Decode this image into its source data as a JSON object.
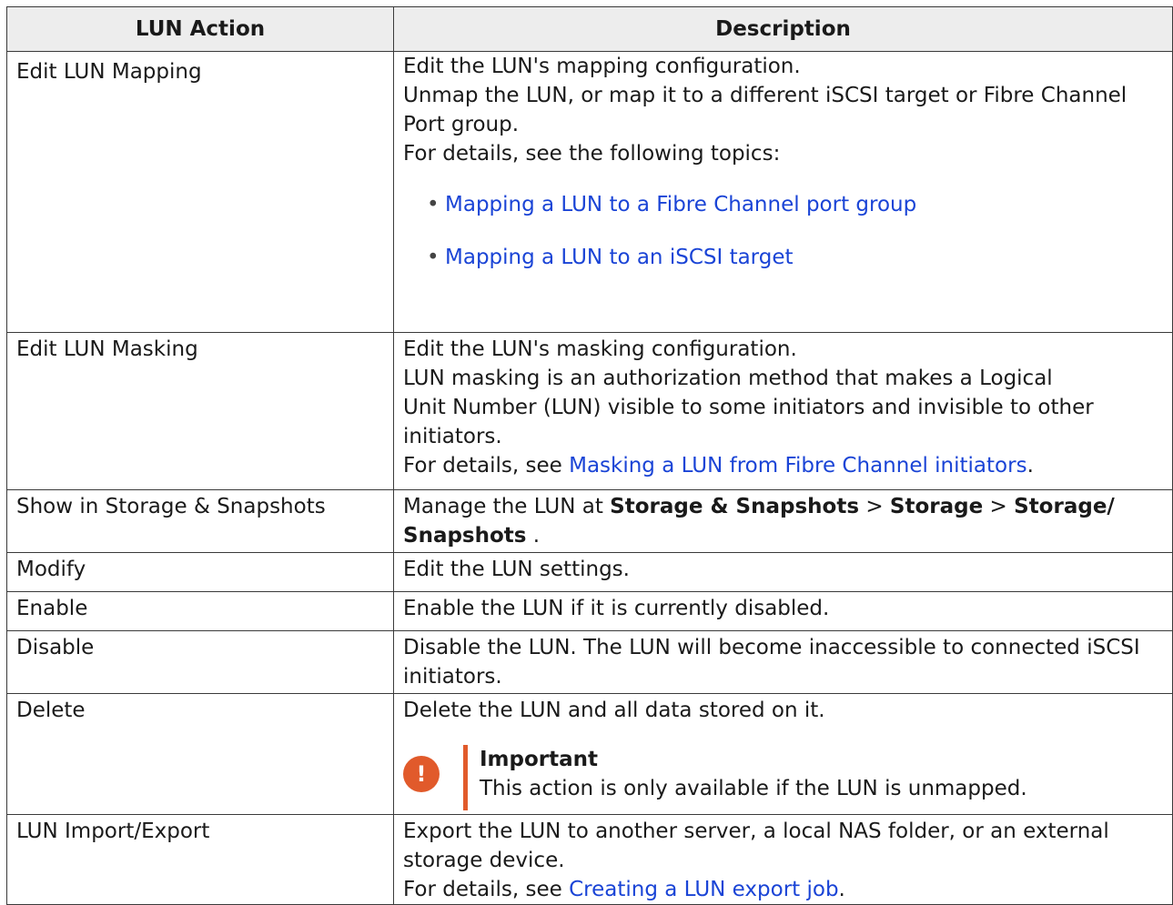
{
  "headers": {
    "action": "LUN Action",
    "description": "Description"
  },
  "rows": {
    "edit_mapping": {
      "action": "Edit LUN Mapping",
      "line1": "Edit the LUN's mapping configuration.",
      "line2": "Unmap the LUN, or map it to a different iSCSI target or Fibre Channel",
      "line3": "Port group.",
      "line4": "For details, see the following topics:",
      "link1": "Mapping a LUN to a Fibre Channel port group",
      "link2": "Mapping a LUN to an iSCSI target"
    },
    "edit_masking": {
      "action": "Edit LUN Masking",
      "line1": "Edit the LUN's masking configuration.",
      "line2": "LUN masking is an authorization method that makes a Logical",
      "line3": "Unit Number (LUN) visible to some initiators and invisible to other",
      "line4": "initiators.",
      "details_prefix": "For details, see ",
      "link": "Masking a LUN from Fibre Channel initiators",
      "suffix": "."
    },
    "show_in_storage": {
      "action": "Show in Storage & Snapshots",
      "prefix": "Manage the LUN at ",
      "b1": "Storage & Snapshots",
      "sep1": " > ",
      "b2": "Storage",
      "sep2": " > ",
      "b3": "Storage/",
      "b4": "Snapshots",
      "suffix": " ."
    },
    "modify": {
      "action": "Modify",
      "description": "Edit the LUN settings."
    },
    "enable": {
      "action": "Enable",
      "description": "Enable the LUN if it is currently disabled."
    },
    "disable": {
      "action": "Disable",
      "line1": "Disable the LUN. The LUN will become inaccessible to connected iSCSI",
      "line2": "initiators."
    },
    "delete": {
      "action": "Delete",
      "description": "Delete the LUN and all data stored on it.",
      "notice_icon": "!",
      "notice_title": "Important",
      "notice_text": "This action is only available if the LUN is unmapped."
    },
    "import_export": {
      "action": "LUN Import/Export",
      "line1": "Export the LUN to another server, a local NAS folder, or an external",
      "line2": "storage device.",
      "details_prefix": "For details, see ",
      "link": "Creating a LUN export job",
      "suffix": "."
    }
  },
  "colors": {
    "link": "#1a44d6",
    "header_bg": "#ededed",
    "important_accent": "#e15a2b"
  }
}
